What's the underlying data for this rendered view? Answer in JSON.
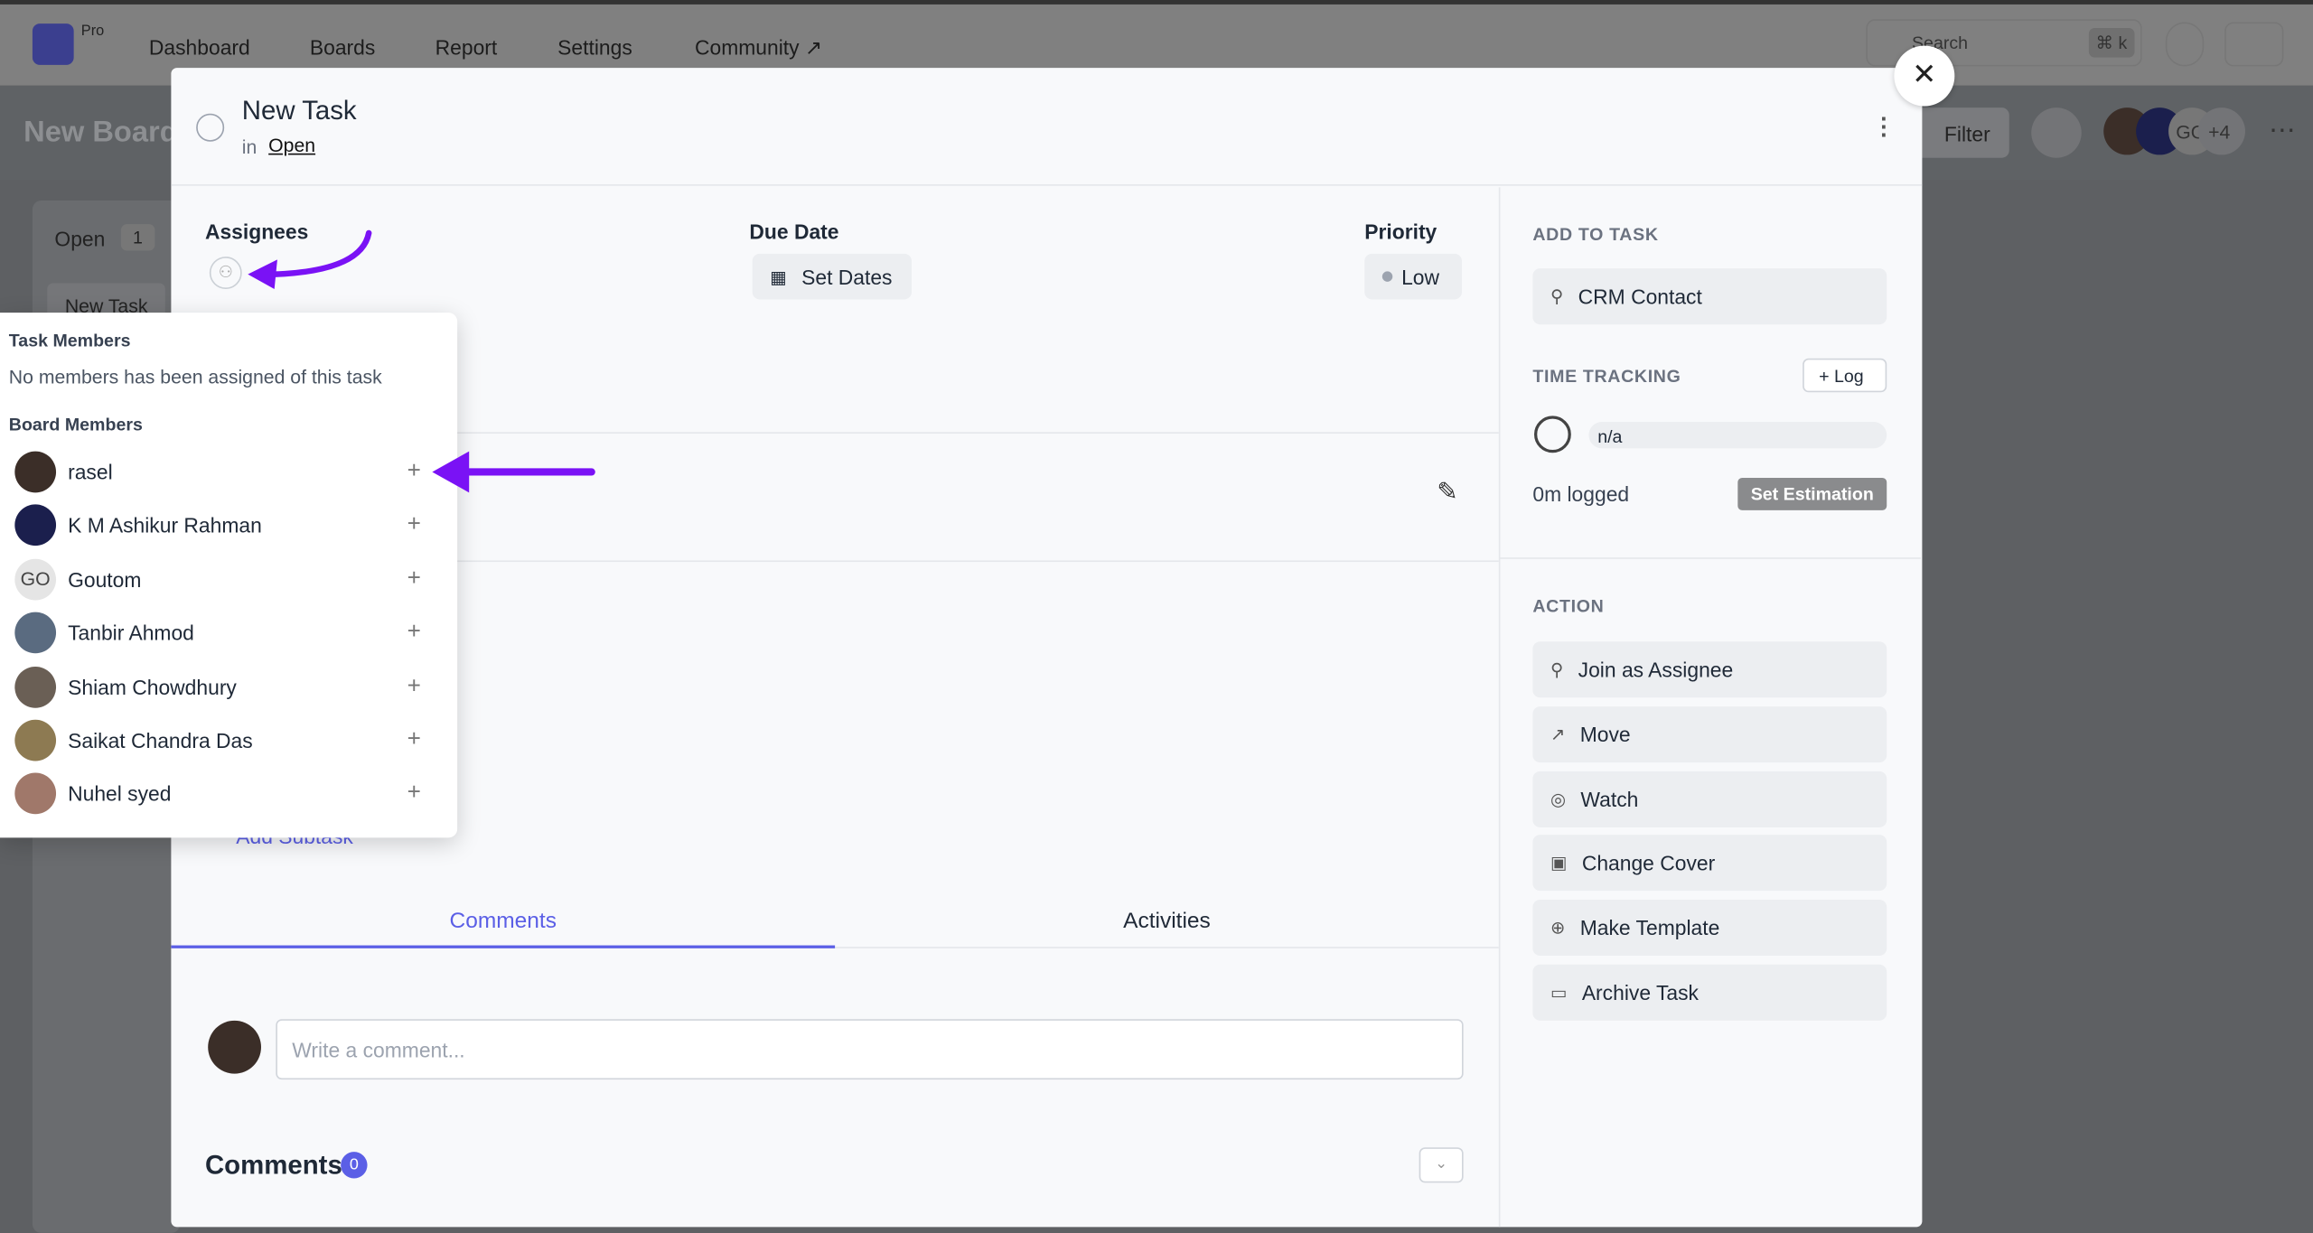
{
  "topbar": {
    "pro": "Pro",
    "nav": [
      "Dashboard",
      "Boards",
      "Report",
      "Settings",
      "Community ↗"
    ],
    "search_placeholder": "Search",
    "shortcut": "⌘ k"
  },
  "board": {
    "title": "New Board",
    "filter": "Filter",
    "extra_count": "+4",
    "initials": "GO",
    "column": "Open",
    "column_count": "1",
    "card": "New Task"
  },
  "task": {
    "title": "New Task",
    "in": "in",
    "status": "Open",
    "assignees_label": "Assignees",
    "due_label": "Due Date",
    "set_dates": "Set Dates",
    "priority_label": "Priority",
    "priority": "Low",
    "add_subtask": "Add Subtask",
    "tabs": [
      "Comments",
      "Activities"
    ],
    "comment_placeholder": "Write a comment...",
    "comments_heading": "Comments",
    "comments_count": "0"
  },
  "sidebar": {
    "add_to_task": "ADD TO TASK",
    "crm": "CRM Contact",
    "time_tracking": "TIME TRACKING",
    "log": "Log",
    "time_value": "n/a",
    "logged": "0m logged",
    "set_estimation": "Set Estimation",
    "action": "ACTION",
    "actions": [
      "Join as Assignee",
      "Move",
      "Watch",
      "Change Cover",
      "Make Template",
      "Archive Task"
    ]
  },
  "dropdown": {
    "task_members": "Task Members",
    "no_members": "No members has been assigned of this task",
    "board_members": "Board Members",
    "members": [
      {
        "name": "rasel",
        "color": "#3b2e28"
      },
      {
        "name": "K M Ashikur Rahman",
        "color": "#1b1f4d"
      },
      {
        "name": "Goutom",
        "initials": "GO",
        "color": "#e5e5e5"
      },
      {
        "name": "Tanbir Ahmod",
        "color": "#5a6b80"
      },
      {
        "name": "Shiam Chowdhury",
        "color": "#6a5f55"
      },
      {
        "name": "Saikat Chandra Das",
        "color": "#8d7a52"
      },
      {
        "name": "Nuhel syed",
        "color": "#a0786a"
      }
    ]
  },
  "colors": {
    "accent": "#5b5fe6",
    "annotation": "#7a12f5"
  }
}
